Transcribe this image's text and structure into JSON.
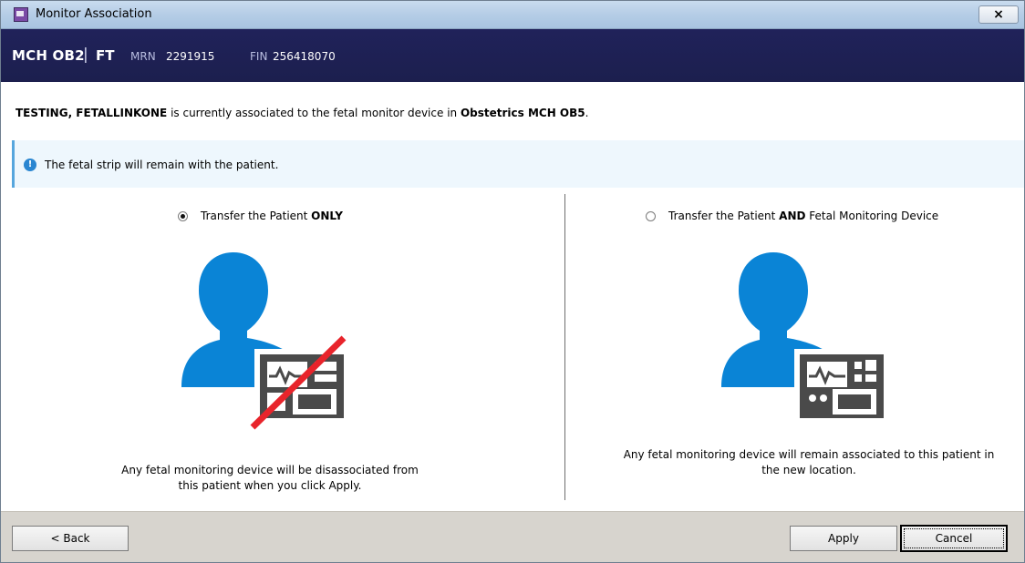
{
  "window": {
    "title": "Monitor Association",
    "close_label": "×"
  },
  "patient": {
    "unit": "MCH OB2",
    "separator": "|",
    "bed": "FT",
    "mrn_label": "MRN",
    "mrn": "2291915",
    "fin_label": "FIN",
    "fin": "256418070"
  },
  "message": {
    "patient_name": "TESTING, FETALLINKONE",
    "text_middle": " is currently associated to the fetal monitor device in ",
    "location": "Obstetrics MCH OB5",
    "text_end": "."
  },
  "info": {
    "icon": "info-icon",
    "text": "The fetal strip will remain with the patient."
  },
  "options": {
    "left": {
      "label_prefix": "Transfer the Patient ",
      "label_bold": "ONLY",
      "label_suffix": "",
      "selected": true,
      "desc_line1": "Any fetal monitoring device will be disassociated from",
      "desc_line2": "this patient when you click Apply."
    },
    "right": {
      "label_prefix": "Transfer the Patient ",
      "label_bold": "AND",
      "label_suffix": " Fetal Monitoring Device",
      "selected": false,
      "desc_line1": "Any fetal monitoring device will remain associated to this patient in",
      "desc_line2": "the new location."
    }
  },
  "footer": {
    "back_label": "< Back",
    "apply_label": "Apply",
    "cancel_label": "Cancel"
  },
  "colors": {
    "header_bg": "#1e2150",
    "person_blue": "#0a84d6",
    "monitor_gray": "#4a4a4a",
    "strike_red": "#e8242b"
  }
}
